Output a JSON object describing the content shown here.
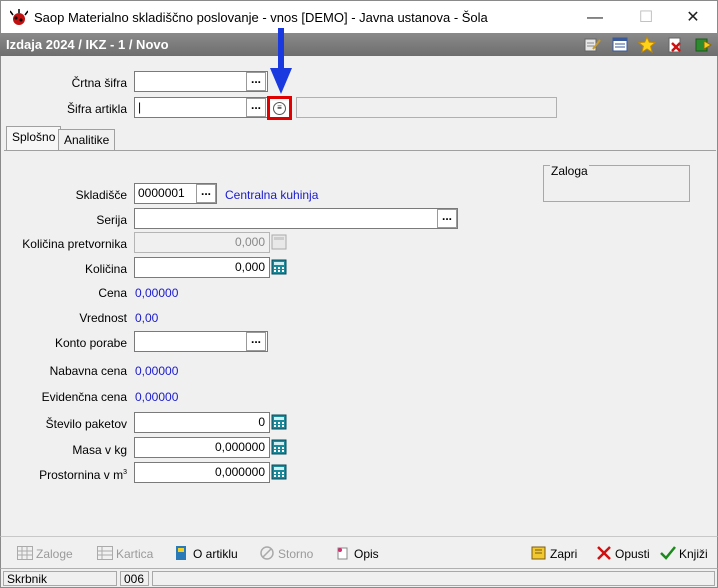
{
  "window": {
    "title": "Saop Materialno skladiščno poslovanje - vnos [DEMO] - Javna ustanova - Šola",
    "minimize": "—",
    "maximize": "☐",
    "close": "✕"
  },
  "form": {
    "subtitle": "Izdaja 2024 / IKZ - 1 / Novo"
  },
  "header_fields": {
    "crtna_sifra_label": "Črtna šifra",
    "sifra_artikla_label": "Šifra artikla",
    "crtna_sifra_value": "",
    "sifra_artikla_value": "|"
  },
  "tabs": [
    {
      "label": "Splošno",
      "active": true
    },
    {
      "label": "Analitike",
      "active": false
    }
  ],
  "zaloga_label": "Zaloga",
  "fields": {
    "skladisce_label": "Skladišče",
    "skladisce_value": "0000001",
    "skladisce_name": "Centralna kuhinja",
    "serija_label": "Serija",
    "serija_value": "",
    "kolicina_pretvornika_label": "Količina pretvornika",
    "kolicina_pretvornika_value": "0,000",
    "kolicina_label": "Količina",
    "kolicina_value": "0,000",
    "cena_label": "Cena",
    "cena_value": "0,00000",
    "vrednost_label": "Vrednost",
    "vrednost_value": "0,00",
    "konto_porabe_label": "Konto porabe",
    "konto_porabe_value": "",
    "nabavna_cena_label": "Nabavna cena",
    "nabavna_cena_value": "0,00000",
    "evidencna_cena_label": "Evidenčna cena",
    "evidencna_cena_value": "0,00000",
    "stevilo_paketov_label": "Število paketov",
    "stevilo_paketov_value": "0",
    "masa_label": "Masa v kg",
    "masa_value": "0,000000",
    "prostornina_label": "Prostornina v m",
    "prostornina_sup": "3",
    "prostornina_value": "0,000000"
  },
  "buttons": {
    "dots": "...",
    "zaloge": "Zaloge",
    "kartica": "Kartica",
    "o_artiklu": "O artiklu",
    "storno": "Storno",
    "opis": "Opis",
    "zapri": "Zapri",
    "opusti": "Opusti",
    "knjizi": "Knjiži"
  },
  "status": {
    "user": "Skrbnik",
    "code": "006"
  }
}
